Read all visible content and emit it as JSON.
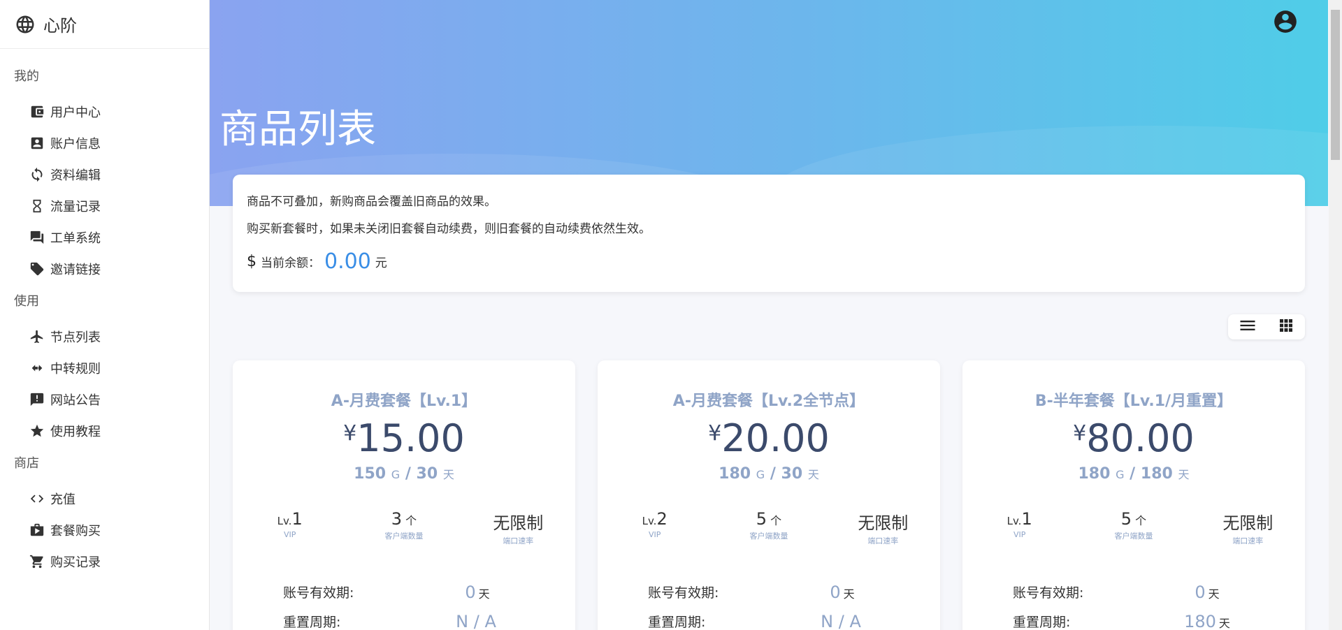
{
  "brand": {
    "name": "心阶",
    "icon": "globe-icon"
  },
  "sidebar": {
    "sections": [
      {
        "title": "我的",
        "items": [
          {
            "label": "用户中心",
            "icon": "wallet-icon"
          },
          {
            "label": "账户信息",
            "icon": "account-box-icon"
          },
          {
            "label": "资料编辑",
            "icon": "sync-icon"
          },
          {
            "label": "流量记录",
            "icon": "hourglass-icon"
          },
          {
            "label": "工单系统",
            "icon": "forum-icon"
          },
          {
            "label": "邀请链接",
            "icon": "tag-icon"
          }
        ]
      },
      {
        "title": "使用",
        "items": [
          {
            "label": "节点列表",
            "icon": "airplane-icon"
          },
          {
            "label": "中转规则",
            "icon": "merge-icon"
          },
          {
            "label": "网站公告",
            "icon": "announcement-icon"
          },
          {
            "label": "使用教程",
            "icon": "star-icon"
          }
        ]
      },
      {
        "title": "商店",
        "items": [
          {
            "label": "充值",
            "icon": "code-icon"
          },
          {
            "label": "套餐购买",
            "icon": "shop-icon"
          },
          {
            "label": "购买记录",
            "icon": "cart-icon"
          }
        ]
      }
    ]
  },
  "header": {
    "title": "商品列表"
  },
  "notice": {
    "line1": "商品不可叠加，新购商品会覆盖旧商品的效果。",
    "line2": "购买新套餐时，如果未关闭旧套餐自动续费，则旧套餐的自动续费依然生效。",
    "balance_label": "当前余额：",
    "balance_value": "0.00",
    "balance_unit": "元"
  },
  "products": [
    {
      "name": "A-月费套餐【Lv.1】",
      "currency": "¥",
      "price": "15.00",
      "traffic": "150",
      "traffic_unit": "G",
      "slash": "/",
      "days": "30",
      "days_unit": "天",
      "level_prefix": "Lv.",
      "level": "1",
      "level_caption": "VIP",
      "clients": "3",
      "clients_unit": "个",
      "clients_caption": "客户端数量",
      "speed": "无限制",
      "speed_caption": "端口速率",
      "validity_label": "账号有效期:",
      "validity_value": "0",
      "validity_unit": "天",
      "reset_label": "重置周期:",
      "reset_value": "N / A",
      "reset_unit": ""
    },
    {
      "name": "A-月费套餐【Lv.2全节点】",
      "currency": "¥",
      "price": "20.00",
      "traffic": "180",
      "traffic_unit": "G",
      "slash": "/",
      "days": "30",
      "days_unit": "天",
      "level_prefix": "Lv.",
      "level": "2",
      "level_caption": "VIP",
      "clients": "5",
      "clients_unit": "个",
      "clients_caption": "客户端数量",
      "speed": "无限制",
      "speed_caption": "端口速率",
      "validity_label": "账号有效期:",
      "validity_value": "0",
      "validity_unit": "天",
      "reset_label": "重置周期:",
      "reset_value": "N / A",
      "reset_unit": ""
    },
    {
      "name": "B-半年套餐【Lv.1/月重置】",
      "currency": "¥",
      "price": "80.00",
      "traffic": "180",
      "traffic_unit": "G",
      "slash": "/",
      "days": "180",
      "days_unit": "天",
      "level_prefix": "Lv.",
      "level": "1",
      "level_caption": "VIP",
      "clients": "5",
      "clients_unit": "个",
      "clients_caption": "客户端数量",
      "speed": "无限制",
      "speed_caption": "端口速率",
      "validity_label": "账号有效期:",
      "validity_value": "0",
      "validity_unit": "天",
      "reset_label": "重置周期:",
      "reset_value": "180",
      "reset_unit": "天"
    }
  ],
  "view_toggle": {
    "list_icon": "list-view-icon",
    "grid_icon": "grid-view-icon"
  },
  "colors": {
    "accent": "#3a8ee6",
    "muted": "#8fa4c7",
    "banner_start": "#8aa3f0",
    "banner_end": "#4fcde8"
  }
}
